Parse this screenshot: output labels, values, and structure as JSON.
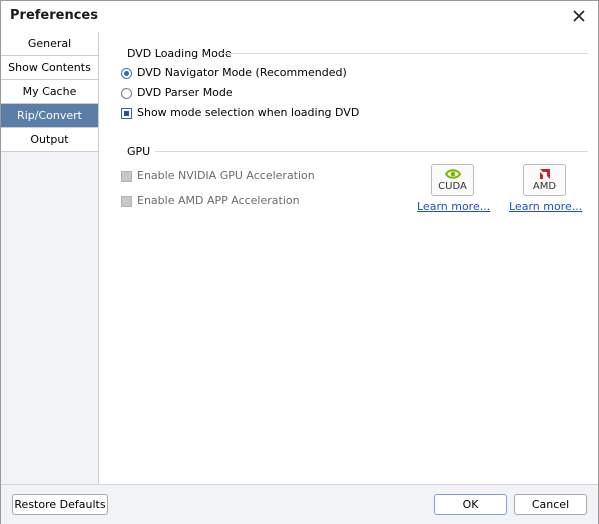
{
  "window": {
    "title": "Preferences"
  },
  "sidebar": {
    "items": [
      {
        "label": "General"
      },
      {
        "label": "Show Contents"
      },
      {
        "label": "My Cache"
      },
      {
        "label": "Rip/Convert",
        "active": true
      },
      {
        "label": "Output"
      }
    ]
  },
  "dvd_loading": {
    "title": "DVD Loading Mode",
    "navigator_label": "DVD Navigator Mode (Recommended)",
    "parser_label": "DVD Parser Mode",
    "show_mode_label": "Show mode selection when loading DVD",
    "selected": "navigator",
    "show_mode_checked": true
  },
  "gpu": {
    "title": "GPU",
    "nvidia_label": "Enable NVIDIA GPU Acceleration",
    "amd_label": "Enable AMD APP Acceleration",
    "cuda_logo_text": "CUDA",
    "amd_logo_text": "AMD",
    "cuda_learn_more": "Learn more...",
    "amd_learn_more": "Learn more..."
  },
  "footer": {
    "restore_label": "Restore Defaults",
    "ok_label": "OK",
    "cancel_label": "Cancel"
  },
  "colors": {
    "active_tab": "#5b7ea8",
    "link": "#1d4fc4",
    "nvidia_green": "#76b900",
    "amd_red": "#c0272d"
  }
}
